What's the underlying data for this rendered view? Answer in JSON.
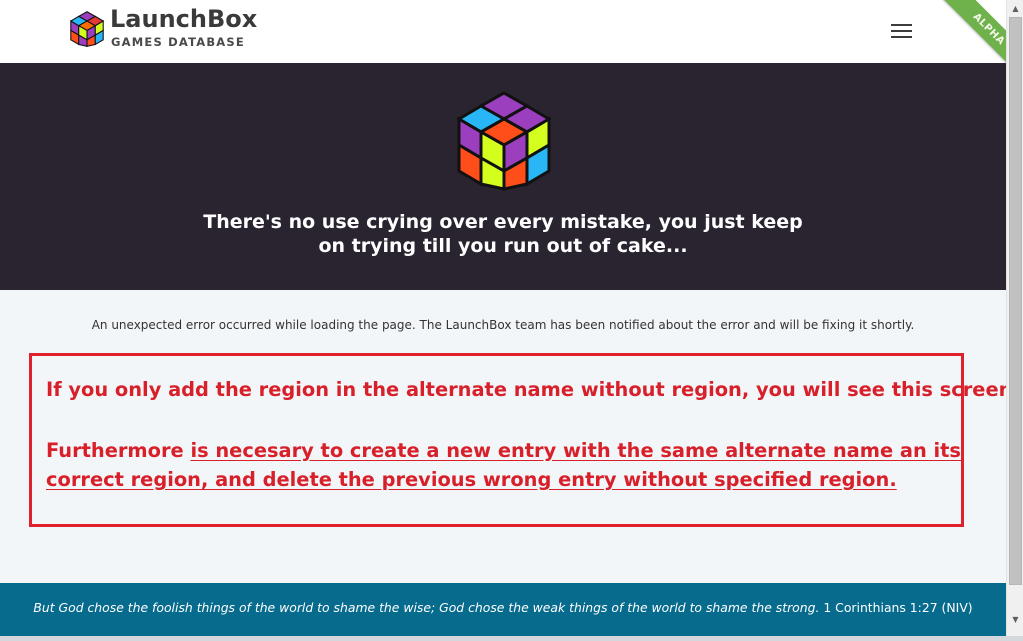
{
  "header": {
    "brand_name": "LaunchBox",
    "brand_subtitle": "GAMES DATABASE",
    "menu_icon": "hamburger-menu-icon",
    "ribbon_label": "ALPHA"
  },
  "hero": {
    "logo_icon": "launchbox-cube-icon",
    "title": "There's no use crying over every mistake, you just keep on trying till you run out of cake..."
  },
  "main": {
    "error_message": "An unexpected error occurred while loading the page. The LaunchBox team has been notified about the error and will be fixing it shortly."
  },
  "annotation": {
    "line1": "If you only add the region in the alternate name without region, you will see this screen.",
    "line2_prefix": "Furthermore ",
    "line2_underlined": "is necesary to create a new entry with the same alternate name an its correct region, and delete the previous wrong entry without specified region."
  },
  "footer": {
    "verse": "But God chose the foolish things of the world to shame the wise; God chose the weak things of the world to shame the strong.",
    "reference": " 1 Corinthians 1:27 (NIV)"
  },
  "colors": {
    "hero_bg": "#2a2430",
    "footer_bg": "#076b8e",
    "annotation_red": "#e0202c",
    "ribbon_green": "#6fb14a"
  }
}
